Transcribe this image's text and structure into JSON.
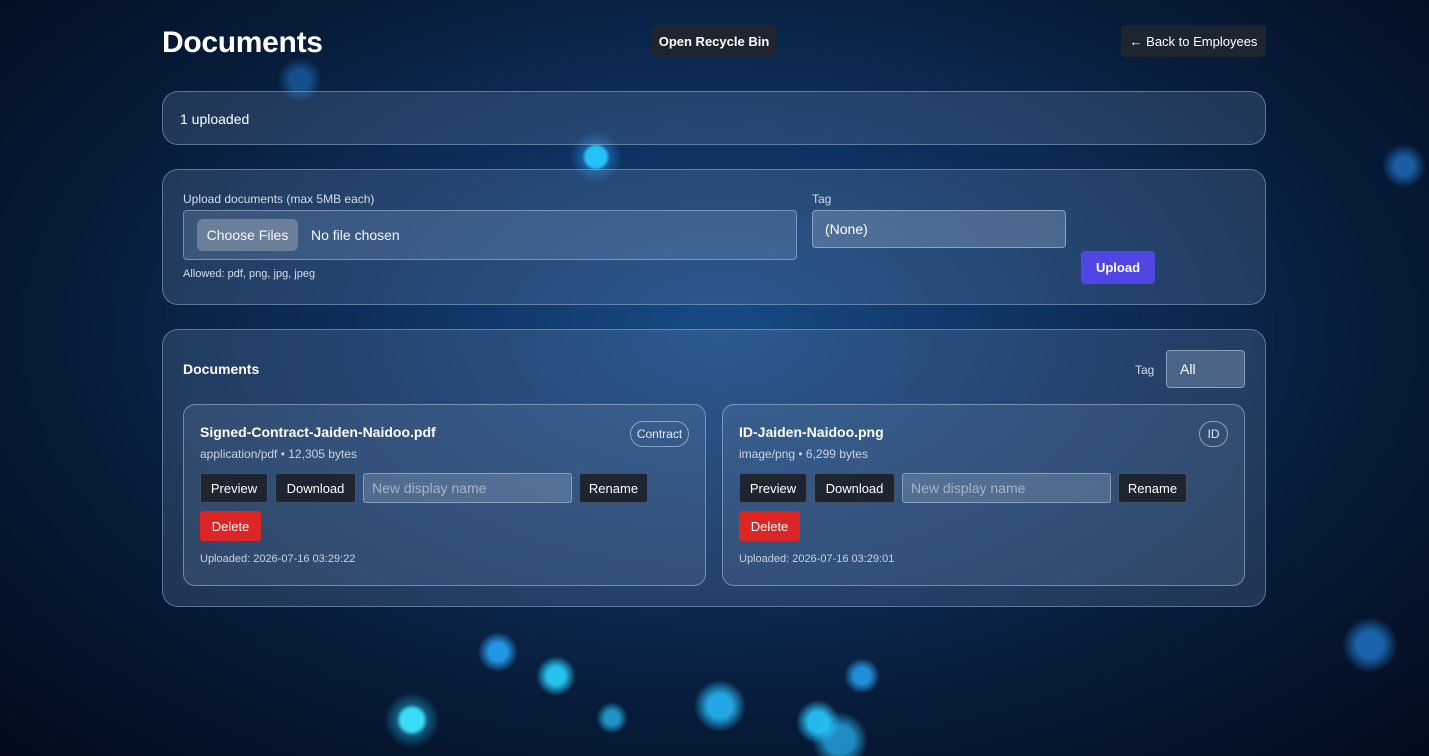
{
  "header": {
    "title": "Documents",
    "recycle_label": "Open Recycle Bin",
    "back_label": "← Back to Employees"
  },
  "status": {
    "text": "1 uploaded"
  },
  "upload": {
    "label": "Upload documents (max 5MB each)",
    "choose_label": "Choose Files",
    "no_file_text": "No file chosen",
    "allowed_text": "Allowed: pdf, png, jpg, jpeg",
    "tag_label": "Tag",
    "tag_value": "(None)",
    "upload_label": "Upload"
  },
  "documents": {
    "title": "Documents",
    "filter_label": "Tag",
    "filter_value": "All",
    "items": [
      {
        "name": "Signed-Contract-Jaiden-Naidoo.pdf",
        "meta": "application/pdf • 12,305 bytes",
        "tag": "Contract",
        "preview_label": "Preview",
        "download_label": "Download",
        "rename_placeholder": "New display name",
        "rename_label": "Rename",
        "delete_label": "Delete",
        "uploaded": "Uploaded: 2026-07-16 03:29:22"
      },
      {
        "name": "ID-Jaiden-Naidoo.png",
        "meta": "image/png • 6,299 bytes",
        "tag": "ID",
        "preview_label": "Preview",
        "download_label": "Download",
        "rename_placeholder": "New display name",
        "rename_label": "Rename",
        "delete_label": "Delete",
        "uploaded": "Uploaded: 2026-07-16 03:29:01"
      }
    ]
  },
  "colors": {
    "primary": "#5046e4",
    "danger": "#dc2626",
    "dark_button": "#1e2430"
  }
}
